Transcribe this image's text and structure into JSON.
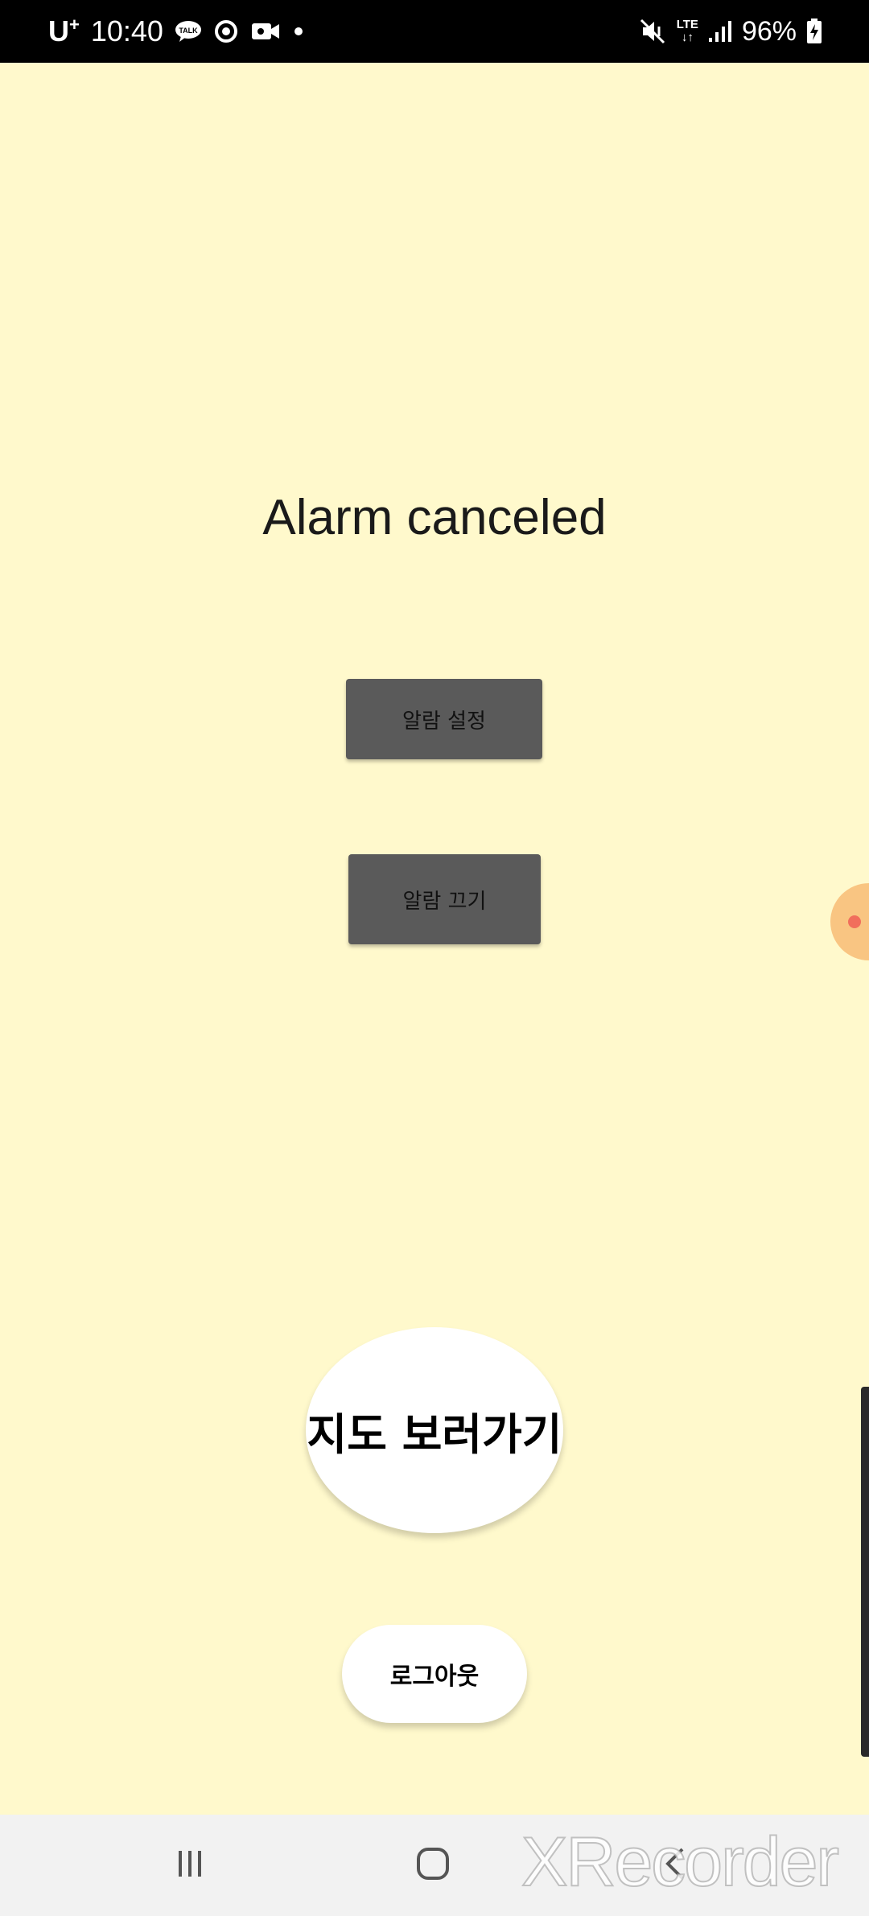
{
  "status_bar": {
    "carrier": "U",
    "carrier_sup": "+",
    "time": "10:40",
    "lte_top": "LTE",
    "lte_bottom": "↓↑",
    "battery": "96%",
    "icons": [
      "talk-icon",
      "sync-icon",
      "video-record-icon",
      "notification-dot-icon",
      "mute-vibrate-icon",
      "lte-icon",
      "signal-icon",
      "battery-charging-icon"
    ]
  },
  "main": {
    "alarm_status": "Alarm canceled",
    "set_alarm_label": "알람 설정",
    "alarm_off_label": "알람 끄기",
    "map_button_label": "지도 보러가기",
    "logout_label": "로그아웃"
  },
  "nav_bar": {
    "icons": [
      "recent-apps-icon",
      "home-icon",
      "back-icon"
    ]
  },
  "watermark": {
    "text": "XRecorder"
  },
  "colors": {
    "background": "#FFF9CC",
    "button_gray": "#5A5A5A",
    "status_bar": "#000000",
    "nav_bar": "#F2F2F2",
    "bubble": "#F9C07A"
  }
}
